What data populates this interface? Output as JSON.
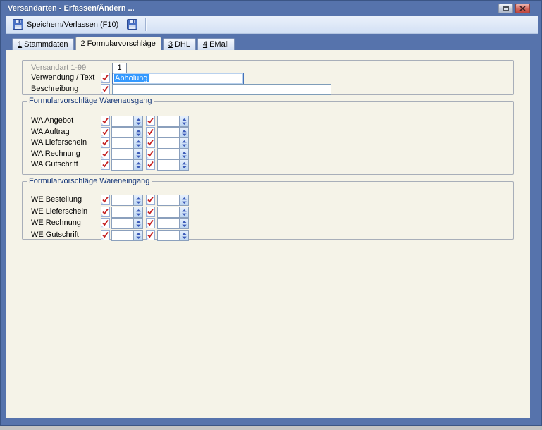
{
  "window": {
    "title": "Versandarten - Erfassen/Ändern ...",
    "icons": {
      "maximize": "restore-box",
      "close": "x"
    }
  },
  "toolbar": {
    "save_label": "Speichern/Verlassen (F10)",
    "icons": {
      "save_primary": "floppy-disk",
      "save_secondary": "floppy-disk"
    }
  },
  "tabs": [
    {
      "num": "1",
      "label": "Stammdaten",
      "active": false
    },
    {
      "num": "2",
      "label": "Formularvorschläge",
      "active": true
    },
    {
      "num": "3",
      "label": "DHL",
      "active": false
    },
    {
      "num": "4",
      "label": "EMail",
      "active": false
    }
  ],
  "form": {
    "versandart_label": "Versandart 1-99",
    "versandart_value": "1",
    "verwendung_label": "Verwendung / Text",
    "verwendung_value": "Abholung",
    "verwendung_selected": true,
    "beschreibung_label": "Beschreibung",
    "beschreibung_value": ""
  },
  "groups": [
    {
      "title": "Formularvorschläge Warenausgang",
      "rows": [
        {
          "label": "WA Angebot",
          "value1": "",
          "value2": ""
        },
        {
          "label": "WA Auftrag",
          "value1": "",
          "value2": ""
        },
        {
          "label": "WA Lieferschein",
          "value1": "",
          "value2": ""
        },
        {
          "label": "WA Rechnung",
          "value1": "",
          "value2": ""
        },
        {
          "label": "WA Gutschrift",
          "value1": "",
          "value2": ""
        }
      ]
    },
    {
      "title": "Formularvorschläge Wareneingang",
      "rows": [
        {
          "label": "WE Bestellung",
          "value1": "",
          "value2": ""
        },
        {
          "label": "WE Lieferschein",
          "value1": "",
          "value2": ""
        },
        {
          "label": "WE Rechnung",
          "value1": "",
          "value2": ""
        },
        {
          "label": "WE Gutschrift",
          "value1": "",
          "value2": ""
        }
      ]
    }
  ],
  "colors": {
    "titlebar": "#5673ac",
    "panel": "#f5f3e8",
    "group_title": "#17387a",
    "check_red": "#c41c1c",
    "selection": "#3399ff",
    "spin_arrow": "#3b5ab8"
  }
}
